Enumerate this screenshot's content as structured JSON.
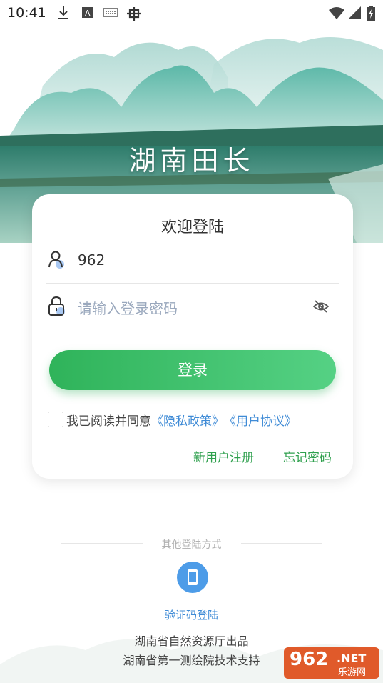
{
  "status_bar": {
    "time": "10:41"
  },
  "banner": {
    "title": "湖南田长"
  },
  "login_card": {
    "title": "欢迎登陆",
    "username_value": "962",
    "password_placeholder": "请输入登录密码",
    "login_button": "登录",
    "agreement": {
      "prefix": "我已阅读并同意",
      "privacy_link": "《隐私政策》",
      "user_link": "《用户协议》"
    },
    "register_link": "新用户注册",
    "forgot_link": "忘记密码"
  },
  "other_login": {
    "label": "其他登陆方式",
    "sms_login": "验证码登陆"
  },
  "footer": {
    "line1": "湖南省自然资源厅出品",
    "line2": "湖南省第一测绘院技术支持"
  },
  "watermark": {
    "main": "962",
    "suffix": ".NET",
    "cn": "乐游网"
  },
  "colors": {
    "primary_green": "#2fb35a",
    "link_blue": "#3f8bd6",
    "icon_blue": "#4d9ce8"
  }
}
